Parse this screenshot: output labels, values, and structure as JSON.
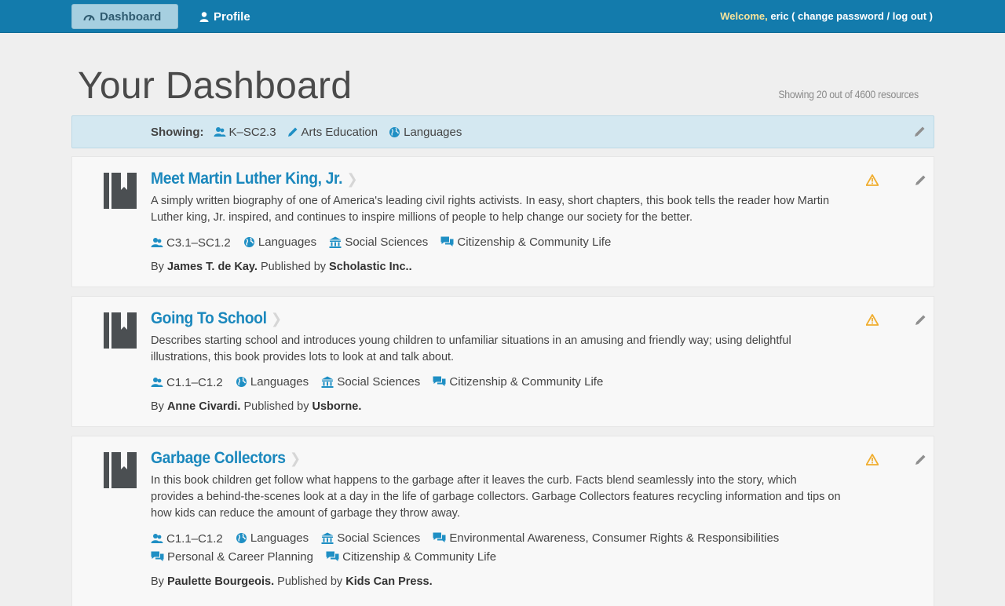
{
  "nav": {
    "dashboard_label": "Dashboard",
    "profile_label": "Profile",
    "welcome_prefix": "Welcome,",
    "username": "eric",
    "change_password": "( change password",
    "separator": "/",
    "log_out": "log out )"
  },
  "header": {
    "title": "Your Dashboard",
    "count_text": "Showing 20 out of 4600 resources"
  },
  "filter": {
    "label": "Showing:",
    "tags": [
      {
        "icon": "users-icon",
        "text": "K–SC2.3"
      },
      {
        "icon": "pencil-icon",
        "text": "Arts Education"
      },
      {
        "icon": "globe-icon",
        "text": "Languages"
      }
    ]
  },
  "resources": [
    {
      "title": "Meet Martin Luther King, Jr.",
      "description": "A simply written biography of one of America's leading civil rights activists. In easy, short chapters, this book tells the reader how Martin Luther king, Jr. inspired, and continues to inspire millions of people to help change our society for the better.",
      "tags": [
        {
          "icon": "users-icon",
          "text": "C3.1–SC1.2"
        },
        {
          "icon": "globe-icon",
          "text": "Languages"
        },
        {
          "icon": "institution-icon",
          "text": "Social Sciences"
        },
        {
          "icon": "comments-icon",
          "text": "Citizenship & Community Life"
        }
      ],
      "by_label": "By",
      "author": "James T. de Kay.",
      "published_label": "Published by",
      "publisher": "Scholastic Inc.."
    },
    {
      "title": "Going To School",
      "description": "Describes starting school and introduces young children to unfamiliar situations in an amusing and friendly way; using delightful illustrations, this book provides lots to look at and talk about.",
      "tags": [
        {
          "icon": "users-icon",
          "text": "C1.1–C1.2"
        },
        {
          "icon": "globe-icon",
          "text": "Languages"
        },
        {
          "icon": "institution-icon",
          "text": "Social Sciences"
        },
        {
          "icon": "comments-icon",
          "text": "Citizenship & Community Life"
        }
      ],
      "by_label": "By",
      "author": "Anne Civardi.",
      "published_label": "Published by",
      "publisher": "Usborne."
    },
    {
      "title": "Garbage Collectors",
      "description": "In this book children get follow what happens to the garbage after it leaves the curb. Facts blend seamlessly into the story, which provides a behind-the-scenes look at a day in the life of garbage collectors. Garbage Collectors features recycling information and tips on how kids can reduce the amount of garbage they throw away.",
      "tags": [
        {
          "icon": "users-icon",
          "text": "C1.1–C1.2"
        },
        {
          "icon": "globe-icon",
          "text": "Languages"
        },
        {
          "icon": "institution-icon",
          "text": "Social Sciences"
        },
        {
          "icon": "comments-icon",
          "text": "Environmental Awareness, Consumer Rights & Responsibilities"
        },
        {
          "icon": "comments-icon",
          "text": "Personal & Career Planning"
        },
        {
          "icon": "comments-icon",
          "text": "Citizenship & Community Life"
        }
      ],
      "by_label": "By",
      "author": "Paulette Bourgeois.",
      "published_label": "Published by",
      "publisher": "Kids Can Press."
    }
  ],
  "colors": {
    "topbar": "#137bac",
    "link": "#1b88bd",
    "icon_blue": "#1f8fc4",
    "warning": "#f0ad2e",
    "filter_bg": "#d4e8f1"
  }
}
